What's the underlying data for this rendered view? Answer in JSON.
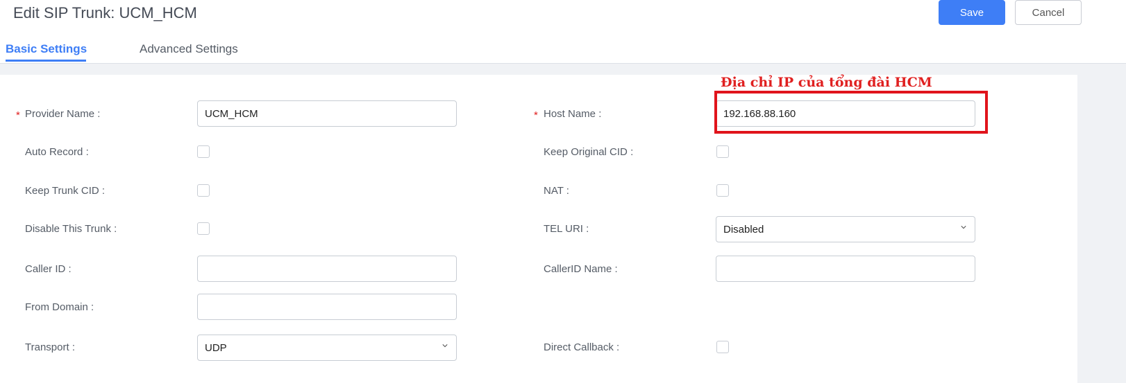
{
  "header": {
    "title": "Edit SIP Trunk: UCM_HCM",
    "save_label": "Save",
    "cancel_label": "Cancel"
  },
  "tabs": [
    {
      "label": "Basic Settings",
      "active": true
    },
    {
      "label": "Advanced Settings",
      "active": false
    }
  ],
  "annotation": {
    "text": "Địa chỉ IP của tổng đài HCM",
    "color": "#e02020"
  },
  "form": {
    "required_mark": "*",
    "provider_name": {
      "label": "Provider Name",
      "value": "UCM_HCM",
      "required": true
    },
    "host_name": {
      "label": "Host Name",
      "value": "192.168.88.160",
      "required": true
    },
    "auto_record": {
      "label": "Auto Record",
      "checked": false
    },
    "keep_original_cid": {
      "label": "Keep Original CID",
      "checked": false
    },
    "keep_trunk_cid": {
      "label": "Keep Trunk CID",
      "checked": false
    },
    "nat": {
      "label": "NAT",
      "checked": false
    },
    "disable_trunk": {
      "label": "Disable This Trunk",
      "checked": false
    },
    "tel_uri": {
      "label": "TEL URI",
      "value": "Disabled"
    },
    "caller_id": {
      "label": "Caller ID",
      "value": ""
    },
    "callerid_name": {
      "label": "CallerID Name",
      "value": ""
    },
    "from_domain": {
      "label": "From Domain",
      "value": ""
    },
    "transport": {
      "label": "Transport",
      "value": "UDP"
    },
    "direct_callback": {
      "label": "Direct Callback",
      "checked": false
    }
  },
  "label_suffix": ":",
  "colors": {
    "accent": "#3e7ef6",
    "required": "#e02020"
  }
}
